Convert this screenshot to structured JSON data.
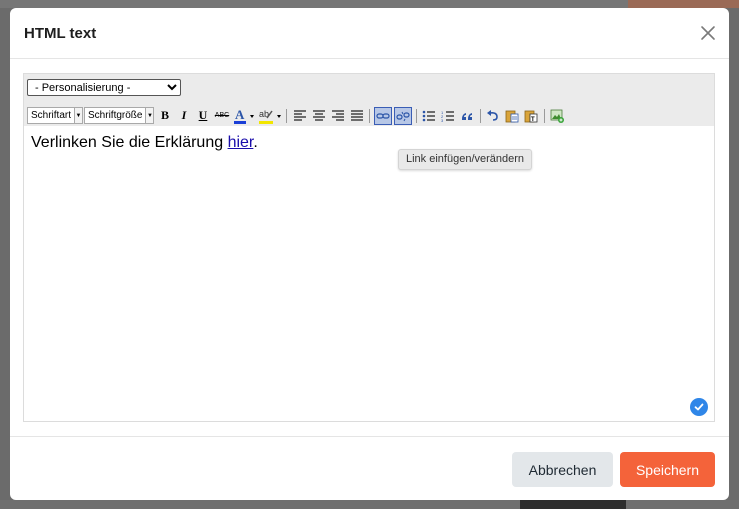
{
  "modal": {
    "title": "HTML text"
  },
  "toolbar": {
    "personalization_select": {
      "selected": "- Personalisierung -",
      "options": [
        "- Personalisierung -"
      ]
    },
    "font_family_label": "Schriftart",
    "font_size_label": "Schriftgröße",
    "buttons": [
      {
        "name": "bold",
        "glyph": "B"
      },
      {
        "name": "italic",
        "glyph": "I"
      },
      {
        "name": "underline",
        "glyph": "U"
      },
      {
        "name": "strikethrough",
        "glyph": "ABC"
      },
      {
        "name": "text-color",
        "glyph": "A"
      },
      {
        "name": "highlight-color",
        "glyph": "ab"
      }
    ],
    "colors": {
      "text_color_bar": "#1a3fd6",
      "highlight_bar": "#f2e600",
      "active_button_bg": "#b7c7e6",
      "icon_blue": "#2b55a8"
    }
  },
  "editor": {
    "text_before_link": "Verlinken Sie die Erklärung ",
    "link_text": "hier",
    "text_after_link": "."
  },
  "tooltip": {
    "text": "Link einfügen/verändern"
  },
  "footer": {
    "cancel_label": "Abbrechen",
    "save_label": "Speichern"
  },
  "colors": {
    "save_button": "#f4633a",
    "cancel_button": "#e3e7ea",
    "check_badge": "#2f86e8",
    "link": "#1a0dab"
  }
}
